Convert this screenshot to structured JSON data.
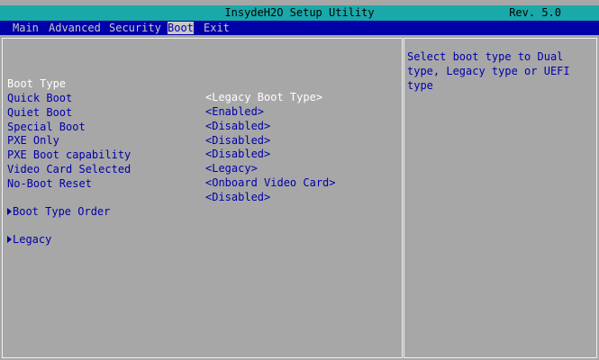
{
  "title": "InsydeH2O Setup Utility",
  "version": "Rev. 5.0",
  "menu": [
    "Main",
    "Advanced",
    "Security",
    "Boot",
    "Exit"
  ],
  "selected_menu": "Boot",
  "settings": [
    {
      "label": "Boot Type",
      "value": "<Legacy Boot Type>"
    },
    {
      "label": "Quick Boot",
      "value": "<Enabled>"
    },
    {
      "label": "Quiet Boot",
      "value": "<Disabled>"
    },
    {
      "label": "Special Boot",
      "value": "<Disabled>"
    },
    {
      "label": "PXE Only",
      "value": "<Disabled>"
    },
    {
      "label": "PXE Boot capability",
      "value": "<Legacy>"
    },
    {
      "label": "Video Card Selected",
      "value": "<Onboard Video Card>"
    },
    {
      "label": "No-Boot Reset",
      "value": "<Disabled>"
    }
  ],
  "submenus": [
    "Boot Type Order",
    "Legacy"
  ],
  "help_text": "Select boot type to Dual type, Legacy type or UEFI type",
  "colors": {
    "accent": "#1aa9a9",
    "menubar": "#0000a8",
    "background": "#a7a7a7",
    "text": "#0000a8",
    "selected_text": "#ffffff"
  },
  "icons": {
    "submenu": "right-triangle-icon"
  }
}
